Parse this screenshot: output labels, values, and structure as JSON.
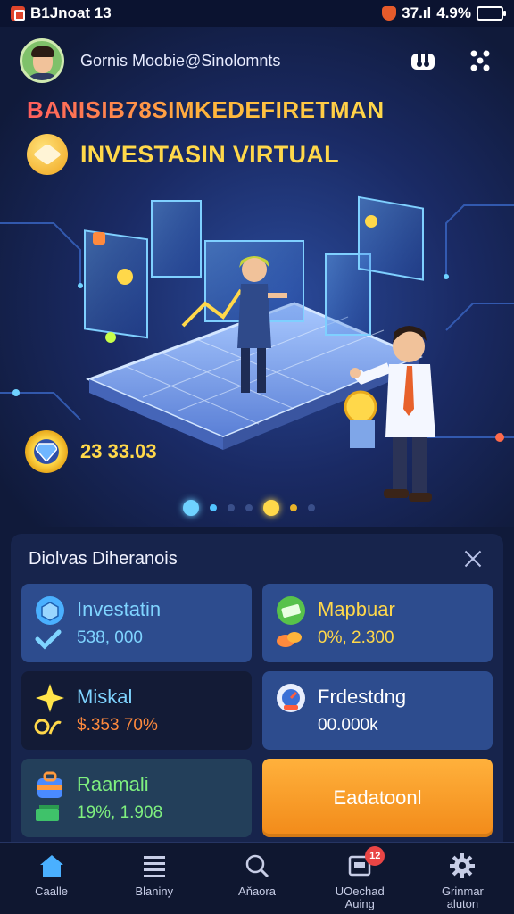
{
  "status_bar": {
    "time": "B1Jnoat 13",
    "signal": "37.ıl",
    "battery_percent": "4.9%",
    "battery_level": 0.8
  },
  "header": {
    "username": "Gornis Moobie@Sinolomnts",
    "icons": [
      "avatar",
      "device-icon",
      "menu-dots-icon"
    ]
  },
  "hero": {
    "headline_top": "BANISIB78SIMKEDEFIRETMAN",
    "headline_main": "INVESTASIN VIRTUAL",
    "balance": "23 33.03",
    "carousel": {
      "count": 7,
      "active_index": 4
    }
  },
  "panel": {
    "title": "Diolvas Diheranois",
    "cards": [
      {
        "title": "Investatin",
        "value": "538, 000",
        "icon": "box-icon",
        "sub_icon": "check-icon",
        "title_color": "#7fd4ff",
        "value_color": "#7fd4ff"
      },
      {
        "title": "Mapbuar",
        "value": "0%, 2.300",
        "icon": "cash-icon",
        "sub_icon": "coins-icon",
        "title_color": "#ffd84a",
        "value_color": "#ffd84a"
      },
      {
        "title": "Miskal",
        "value": "$.353 70%",
        "icon": "sparkle-icon",
        "sub_icon": "sprout-icon",
        "title_color": "#7fd4ff",
        "value_color": "#ff8a3d"
      },
      {
        "title": "Frdestdng",
        "value": "00.000k",
        "icon": "gauge-icon",
        "sub_icon": "",
        "title_color": "#ffffff",
        "value_color": "#ffffff"
      },
      {
        "title": "Raamali",
        "value": "19%, 1.908",
        "icon": "briefcase-icon",
        "sub_icon": "money-stack-icon",
        "title_color": "#7ff07f",
        "value_color": "#7ff07f"
      }
    ],
    "cta_label": "Eadatoonl"
  },
  "bottom_nav": [
    {
      "label": "Caalle",
      "icon": "home-icon"
    },
    {
      "label": "Blaniny",
      "icon": "list-icon"
    },
    {
      "label": "Aňaora",
      "icon": "search-icon"
    },
    {
      "label": "UOechad\nAuing",
      "icon": "inbox-icon",
      "badge": "12"
    },
    {
      "label": "Grinmar\naluton",
      "icon": "gear-icon"
    }
  ],
  "colors": {
    "bg": "#101a3a",
    "gold": "#ffd84a",
    "cta": "#f28a19",
    "panel": "#17244c"
  }
}
